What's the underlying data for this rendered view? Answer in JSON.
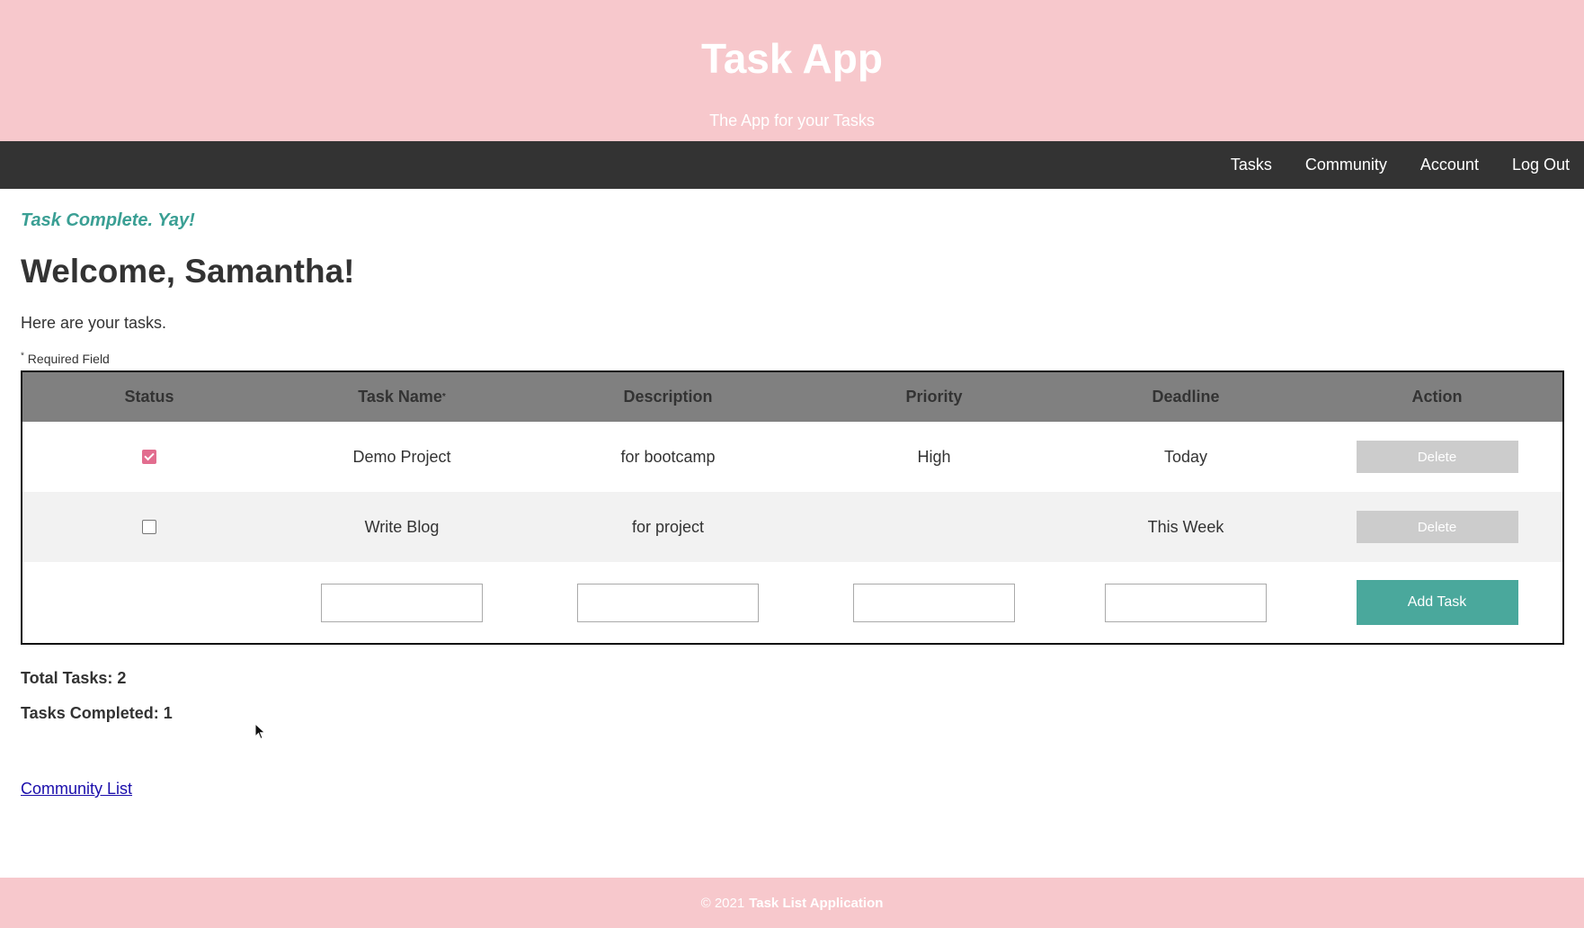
{
  "header": {
    "title": "Task App",
    "tagline": "The App for your Tasks"
  },
  "nav": {
    "items": [
      "Tasks",
      "Community",
      "Account",
      "Log Out"
    ]
  },
  "flash_message": "Task Complete. Yay!",
  "welcome": "Welcome, Samantha!",
  "intro": "Here are your tasks.",
  "required_note": {
    "marker": "*",
    "text": "Required Field"
  },
  "table": {
    "columns": {
      "status": "Status",
      "name": "Task Name",
      "description": "Description",
      "priority": "Priority",
      "deadline": "Deadline",
      "action": "Action"
    },
    "required_marker": "*",
    "rows": [
      {
        "completed": true,
        "name": "Demo Project",
        "description": "for bootcamp",
        "priority": "High",
        "deadline": "Today",
        "action": "Delete"
      },
      {
        "completed": false,
        "name": "Write Blog",
        "description": "for project",
        "priority": "",
        "deadline": "This Week",
        "action": "Delete"
      }
    ],
    "new_row": {
      "name_value": "",
      "description_value": "",
      "priority_value": "",
      "deadline_value": "",
      "add_label": "Add Task"
    }
  },
  "summary": {
    "total": "Total Tasks: 2",
    "completed": "Tasks Completed: 1"
  },
  "community_link": "Community List",
  "footer": {
    "copyright": "© 2021",
    "brand": "Task List Application"
  },
  "colors": {
    "header_bg": "#f7c8cc",
    "nav_bg": "#333333",
    "accent_teal": "#4aa89c",
    "checkbox_pink": "#e26d8f"
  }
}
